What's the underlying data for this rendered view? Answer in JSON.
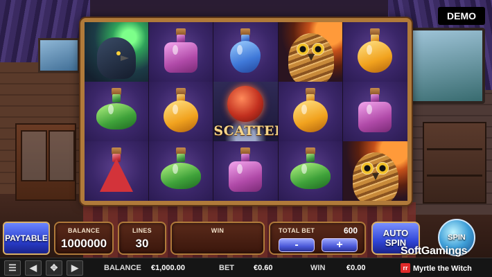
{
  "badge": {
    "mode": "DEMO"
  },
  "reels": [
    [
      "raven-symbol",
      "green-potion",
      "red-potion"
    ],
    [
      "pink-potion",
      "gold-potion",
      "green-potion"
    ],
    [
      "blue-potion",
      "scatter-symbol",
      "pink-potion"
    ],
    [
      "owl-symbol",
      "gold-potion",
      "green-potion"
    ],
    [
      "gold-potion",
      "pink-potion",
      "owl-symbol"
    ]
  ],
  "scatter": {
    "label": "SCATTER"
  },
  "controls": {
    "paytable_label": "PAYTABLE",
    "balance_label": "BALANCE",
    "balance_value": "1000000",
    "lines_label": "LINES",
    "lines_value": "30",
    "win_label": "WIN",
    "total_bet_label": "TOTAL BET",
    "total_bet_value": "600",
    "minus_label": "-",
    "plus_label": "+",
    "auto_label_1": "AUTO",
    "auto_label_2": "SPIN",
    "spin_label": "SPIN"
  },
  "status_bar": {
    "balance_label": "BALANCE",
    "balance_value": "€1,000.00",
    "bet_label": "BET",
    "bet_value": "€0.60",
    "win_label": "WIN",
    "win_value": "€0.00",
    "game_name": "Myrtle the Witch",
    "provider_logo": "SoftGamings"
  }
}
